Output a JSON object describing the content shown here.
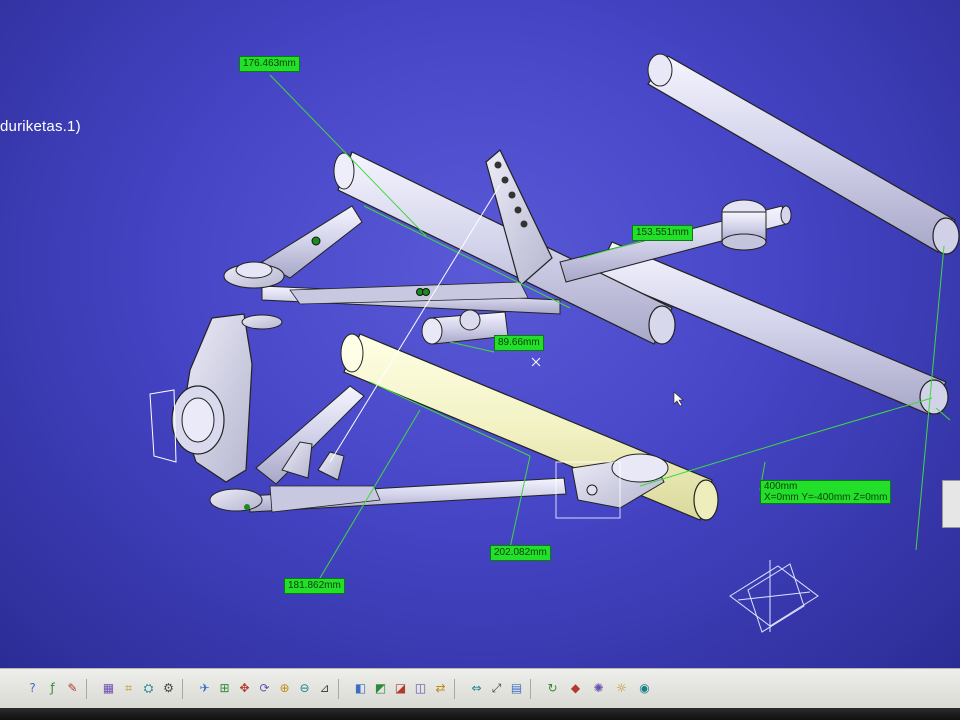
{
  "tree_label": "duriketas.1)",
  "dimensions": {
    "d1": "176.463mm",
    "d2": "153.551mm",
    "d3": "89.66mm",
    "d4": "202.082mm",
    "d5": "181.862mm"
  },
  "coords": {
    "line1": "400mm",
    "line2": "X=0mm   Y=-400mm   Z=0mm"
  },
  "colors": {
    "background": "#4545c6",
    "part": "#d2d2ea",
    "highlight": "#f4f4c0",
    "dimension": "#22e02a"
  },
  "toolbar": {
    "icons": [
      "help-icon",
      "formula-icon",
      "comment-icon",
      "catalog-icon",
      "tree-icon",
      "parts-icon",
      "knowledge-icon",
      "fly-icon",
      "fit-all-icon",
      "pan-icon",
      "rotate-icon",
      "zoom-in-icon",
      "zoom-out-icon",
      "normal-view-icon",
      "view-mode-icon",
      "shading-icon",
      "material-icon",
      "hide-show-icon",
      "swap-icon",
      "measure-icon",
      "measure-item-icon",
      "analysis-icon",
      "update-icon",
      "apply-material-icon",
      "render-icon",
      "light-icon",
      "camera-icon"
    ]
  }
}
